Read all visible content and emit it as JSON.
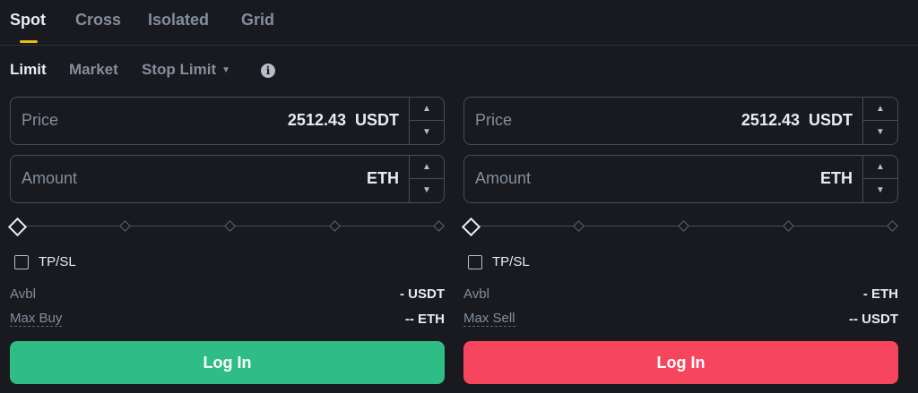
{
  "tabs": [
    "Spot",
    "Cross",
    "Isolated",
    "Grid"
  ],
  "order_types": {
    "limit": "Limit",
    "market": "Market",
    "stop_limit": "Stop Limit",
    "info_icon": "i"
  },
  "buy": {
    "price_label": "Price",
    "price_value": "2512.43",
    "price_unit": "USDT",
    "amount_label": "Amount",
    "amount_value": "",
    "amount_unit": "ETH",
    "tpsl_label": "TP/SL",
    "avbl_label": "Avbl",
    "avbl_value": "- USDT",
    "max_label": "Max Buy",
    "max_value": "-- ETH",
    "button_label": "Log In",
    "button_color": "#2ebd85"
  },
  "sell": {
    "price_label": "Price",
    "price_value": "2512.43",
    "price_unit": "USDT",
    "amount_label": "Amount",
    "amount_value": "",
    "amount_unit": "ETH",
    "tpsl_label": "TP/SL",
    "avbl_label": "Avbl",
    "avbl_value": "- ETH",
    "max_label": "Max Sell",
    "max_value": "-- USDT",
    "button_label": "Log In",
    "button_color": "#f6465d"
  },
  "icons": {
    "up": "▲",
    "down": "▼",
    "caret": "▼"
  },
  "slider_value": 0,
  "accent_color": "#f0b90b"
}
